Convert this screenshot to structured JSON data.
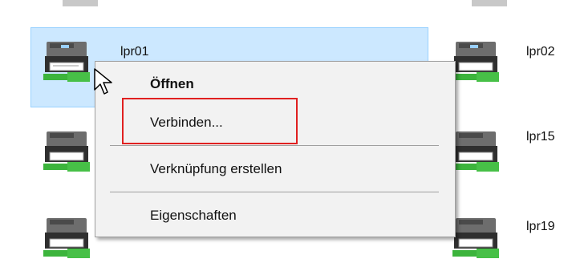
{
  "pane": {
    "printers": [
      {
        "id": "p1",
        "label": "lpr01"
      },
      {
        "id": "p2",
        "label": "lpr02"
      },
      {
        "id": "p3",
        "label": "lpr15"
      },
      {
        "id": "p4",
        "label": "lpr19"
      },
      {
        "id": "p5",
        "label": ""
      },
      {
        "id": "p6",
        "label": ""
      }
    ]
  },
  "context_menu": {
    "open_label": "Öffnen",
    "connect_label": "Verbinden...",
    "create_shortcut_label": "Verknüpfung erstellen",
    "properties_label": "Eigenschaften"
  },
  "colors": {
    "selection_bg": "#cce8ff",
    "annotation_red": "#e02020",
    "menu_bg": "#f2f2f2"
  }
}
